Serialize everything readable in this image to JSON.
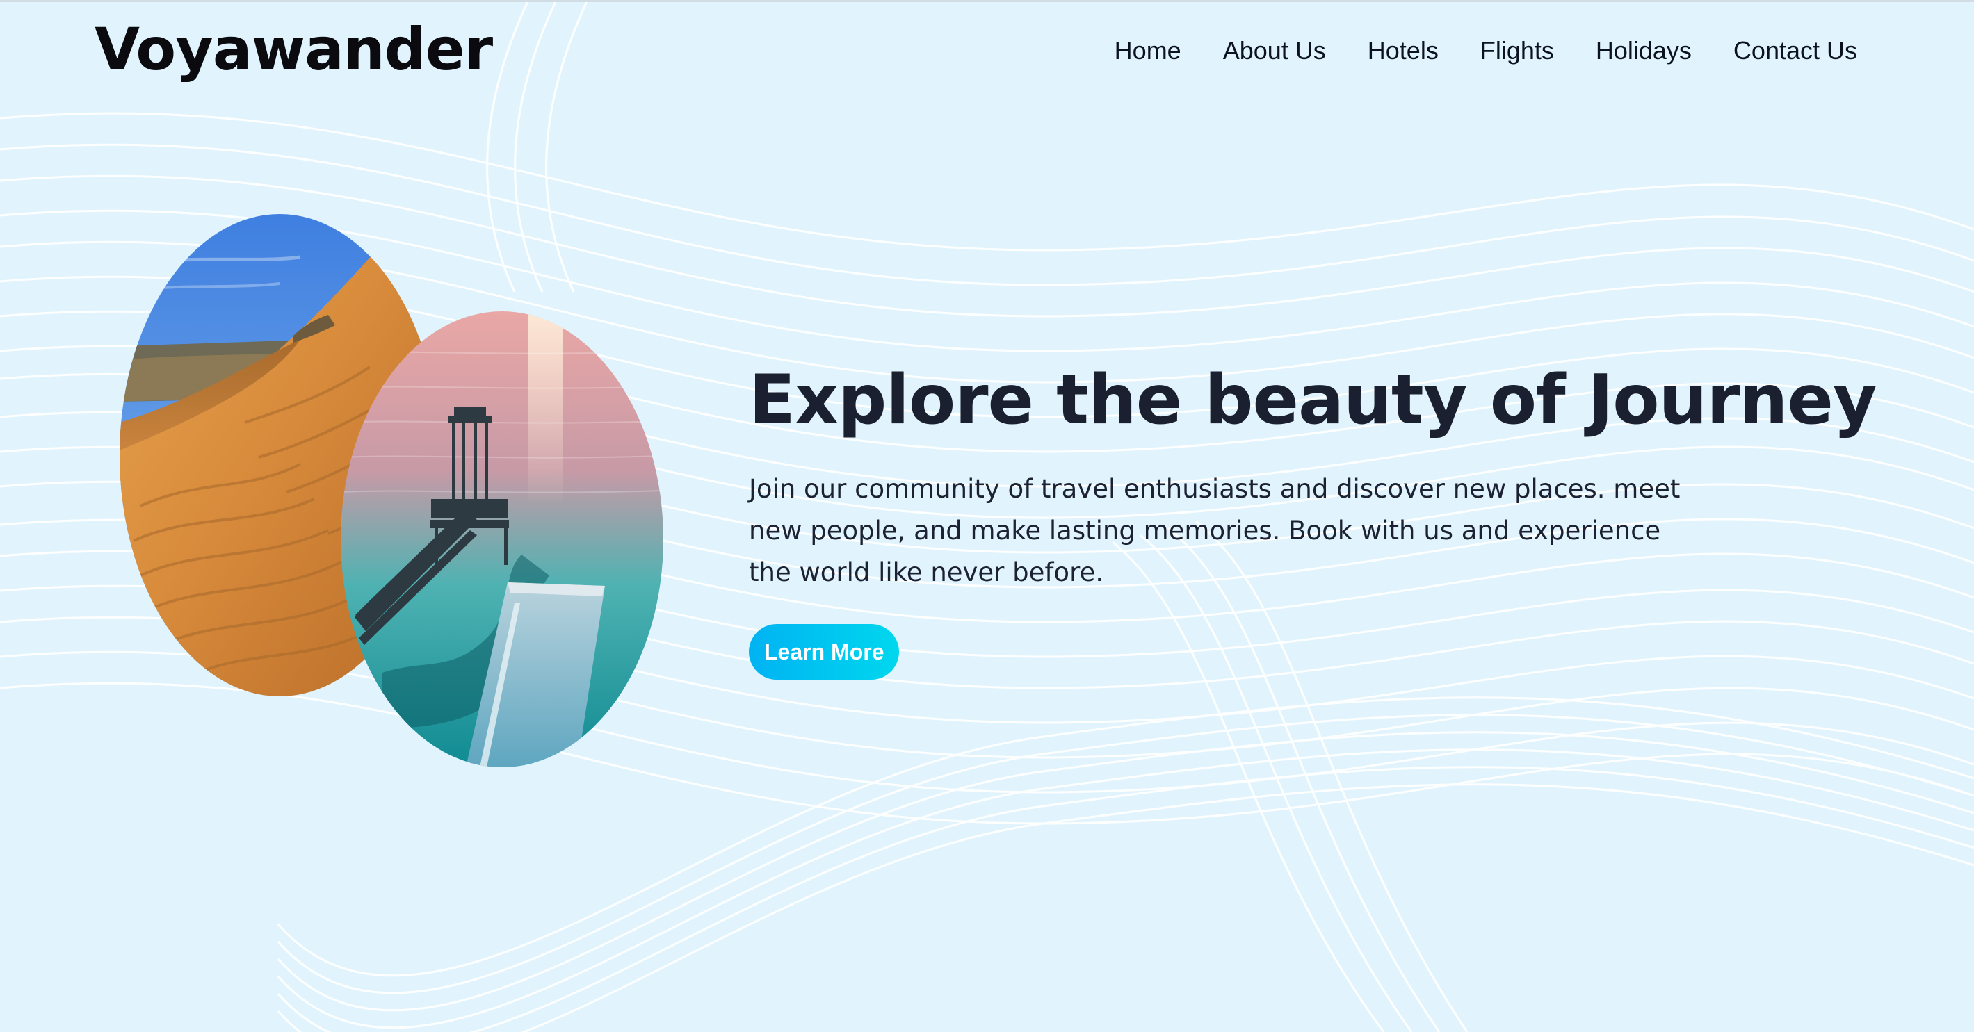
{
  "brand": {
    "name": "Voyawander"
  },
  "nav": {
    "items": [
      {
        "label": "Home"
      },
      {
        "label": "About Us"
      },
      {
        "label": "Hotels"
      },
      {
        "label": "Flights"
      },
      {
        "label": "Holidays"
      },
      {
        "label": "Contact Us"
      }
    ]
  },
  "hero": {
    "title": "Explore the beauty of Journey",
    "text": "Join our community of travel enthusiasts and discover new places. meet new people, and make lasting memories. Book with us and experience the world like never before.",
    "cta_label": "Learn More"
  },
  "images": [
    {
      "name": "desert-dunes-photo"
    },
    {
      "name": "ocean-pier-photo"
    }
  ],
  "colors": {
    "background": "#e1f4fd",
    "accent_start": "#00b3f2",
    "accent_end": "#00d7ee",
    "text": "#1b2030"
  }
}
